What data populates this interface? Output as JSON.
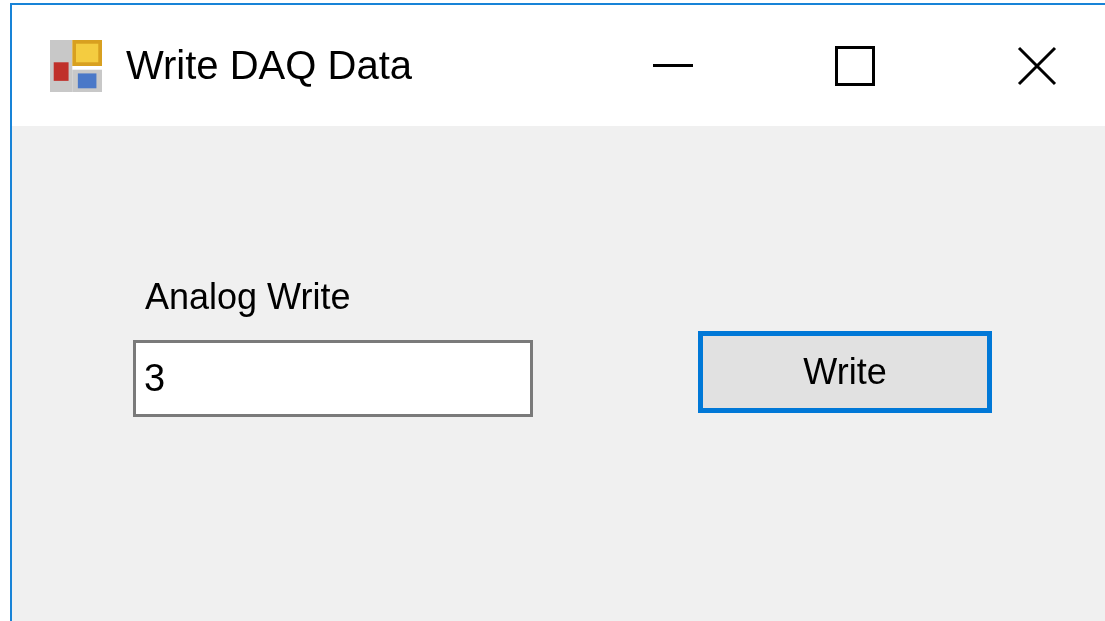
{
  "window": {
    "title": "Write DAQ Data"
  },
  "field": {
    "label": "Analog Write",
    "value": "3"
  },
  "button": {
    "label": "Write",
    "focused": true
  }
}
